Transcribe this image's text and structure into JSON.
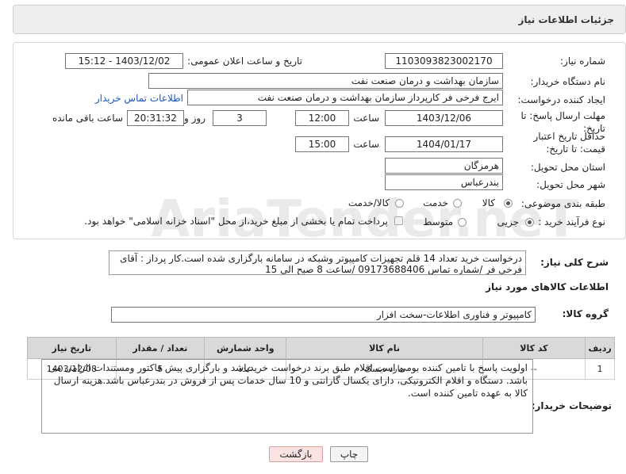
{
  "header": {
    "title": "جزئیات اطلاعات نیاز"
  },
  "fields": {
    "need_number_label": "شماره نیاز:",
    "need_number": "1103093823002170",
    "announce_label": "تاریخ و ساعت اعلان عمومی:",
    "announce_value": "1403/12/02 - 15:12",
    "buyer_org_label": "نام دستگاه خریدار:",
    "buyer_org": "سازمان بهداشت و درمان صنعت نفت",
    "creator_label": "ایجاد کننده درخواست:",
    "creator": "ایرج فرخی فر کارپرداز  سازمان بهداشت و درمان صنعت نفت",
    "contact_link": "اطلاعات تماس خریدار",
    "reply_deadline_label": "مهلت ارسال پاسخ: تا تاریخ:",
    "reply_date": "1403/12/06",
    "time_label": "ساعت",
    "reply_time": "12:00",
    "days": "3",
    "days_label": "روز و",
    "remaining_time": "20:31:32",
    "remaining_label": "ساعت باقی مانده",
    "price_validity_label": "حداقل تاریخ اعتبار قیمت: تا تاریخ:",
    "price_date": "1404/01/17",
    "price_time": "15:00",
    "province_label": "استان محل تحویل:",
    "province": "هرمزگان",
    "city_label": "شهر محل تحویل:",
    "city": "بندرعباس",
    "category_label": "طبقه بندی موضوعی:",
    "category_options": [
      "کالا",
      "خدمت",
      "کالا/خدمت"
    ],
    "category_selected": "کالا",
    "process_label": "نوع فرآیند خرید :",
    "process_options": [
      "جزیی",
      "متوسط"
    ],
    "process_selected": "جزیی",
    "payment_note": "پرداخت تمام یا بخشی از مبلغ خرید،از محل \"اسناد خزانه اسلامی\" خواهد بود."
  },
  "description": {
    "label": "شرح کلی نیاز:",
    "text": "درخواست خرید تعداد 14 قلم تجهیزات کامپیوتر وشبکه در سامانه بارگزاری شده است.کار پرداز : آقای فرخی فر /شماره تماس 09173688406 /ساعت 8 صبح الی 15"
  },
  "goods": {
    "section_title": "اطلاعات کالاهای مورد نیاز",
    "group_label": "گروه کالا:",
    "group_value": "کامپیوتر و فناوری اطلاعات-سخت افزار",
    "columns": [
      "ردیف",
      "کد کالا",
      "نام کالا",
      "واحد شمارش",
      "تعداد / مقدار",
      "تاریخ نیاز"
    ],
    "rows": [
      [
        "1",
        "--",
        "هارد دیسک",
        "عدد",
        "5",
        "1403/12/08"
      ]
    ]
  },
  "notes": {
    "label": "توضیحات خریدار:",
    "text": "اولویت پاسخ با تامین کننده بومی است.اقلام طبق برند درخواست خریدباشد و بارگزاری پیش فاکتور ومستندات الزامی می باشد. دستگاه و اقلام  الکترونیکی، دارای یکسال گارانتی و 10 سال خدمات پس از فروش در بندرعباس باشد.هزینه ارسال کالا به عهده تامین کننده است."
  },
  "buttons": {
    "print": "چاپ",
    "back": "بازگشت"
  },
  "colors": {
    "link": "#1a56b8",
    "back_button_bg": "#fbe3e3",
    "header_bg": "#eeeeee"
  }
}
